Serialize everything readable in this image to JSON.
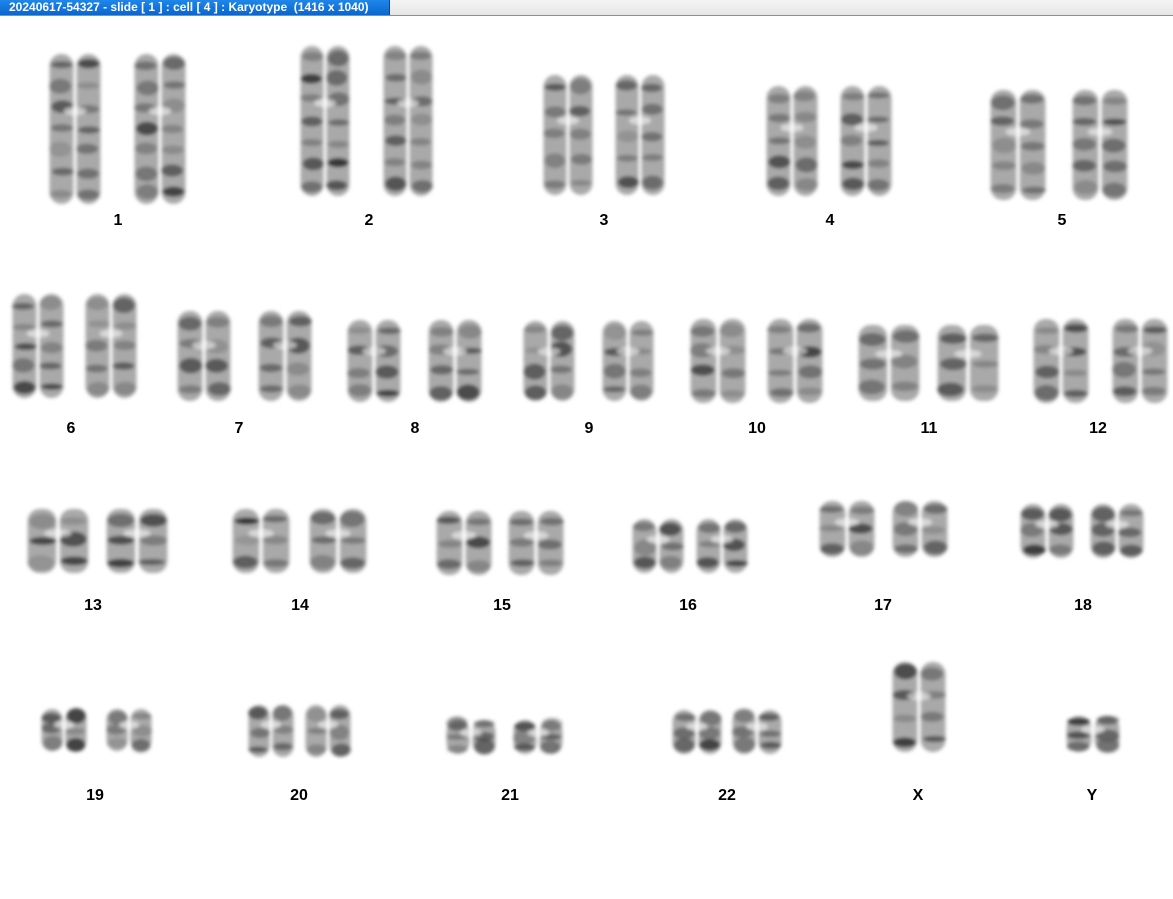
{
  "window": {
    "title": "20240617-54327 - slide [ 1 ] : cell [ 4 ] : Karyotype  (1416 x 1040)",
    "title_bar_color": "#0a6fd8"
  },
  "karyotype": {
    "chromosomes": [
      {
        "label": "1"
      },
      {
        "label": "2"
      },
      {
        "label": "3"
      },
      {
        "label": "4"
      },
      {
        "label": "5"
      },
      {
        "label": "6"
      },
      {
        "label": "7"
      },
      {
        "label": "8"
      },
      {
        "label": "9"
      },
      {
        "label": "10"
      },
      {
        "label": "11"
      },
      {
        "label": "12"
      },
      {
        "label": "13"
      },
      {
        "label": "14"
      },
      {
        "label": "15"
      },
      {
        "label": "16"
      },
      {
        "label": "17"
      },
      {
        "label": "18"
      },
      {
        "label": "19"
      },
      {
        "label": "20"
      },
      {
        "label": "21"
      },
      {
        "label": "22"
      },
      {
        "label": "X"
      },
      {
        "label": "Y"
      }
    ]
  }
}
